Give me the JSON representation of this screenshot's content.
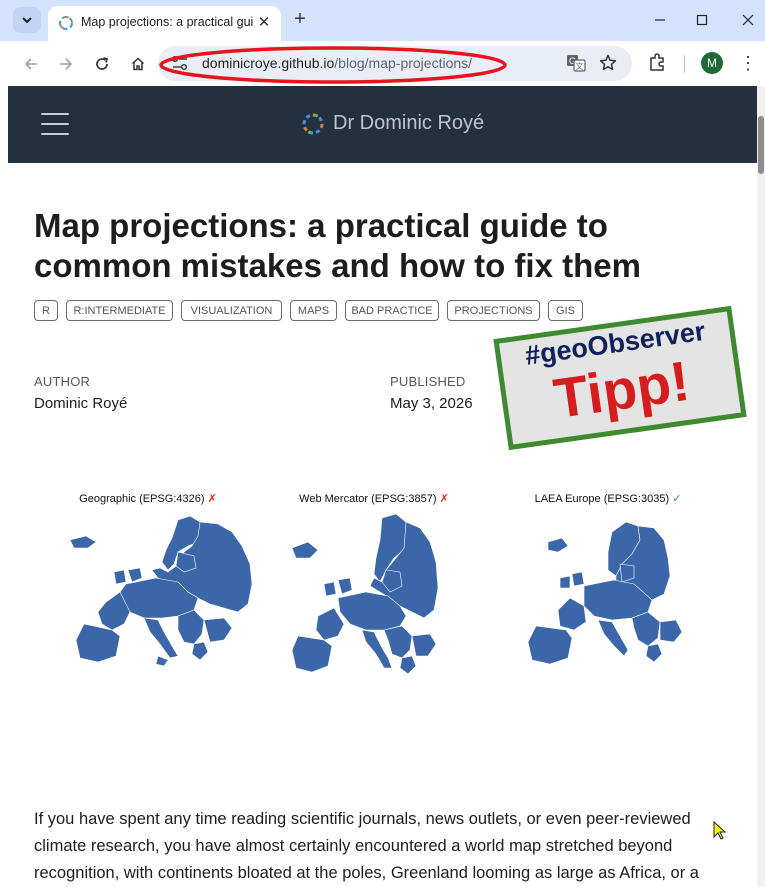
{
  "browser": {
    "tab": {
      "title": "Map projections: a practical guide to common mistakes and how to fix them"
    },
    "url": {
      "host": "dominicroye.github.io",
      "path": "/blog/map-projections/"
    },
    "profile_initial": "M",
    "icons": [
      "tab-search-icon",
      "favicon-icon",
      "close-icon",
      "new-tab-icon",
      "minimize-icon",
      "maximize-icon",
      "window-close-icon",
      "back-icon",
      "forward-icon",
      "reload-icon",
      "home-icon",
      "site-info-icon",
      "translate-icon",
      "star-icon",
      "extensions-icon",
      "more-icon"
    ],
    "annotation_color": "#e8141c"
  },
  "site": {
    "name": "Dr Dominic Royé",
    "header_color": "#24303e"
  },
  "post": {
    "title": "Map projections: a practical guide to common mistakes and how to fix them",
    "tags": [
      "R",
      "R:INTERMEDIATE",
      "VISUALIZATION",
      "MAPS",
      "BAD PRACTICE",
      "PROJECTIONS",
      "GIS"
    ],
    "author_label": "AUTHOR",
    "author": "Dominic Royé",
    "published_label": "PUBLISHED",
    "published": "May 3, 2026",
    "figure": {
      "panels": [
        {
          "title": "Geographic (EPSG:4326)",
          "mark": "✗"
        },
        {
          "title": "Web Mercator (EPSG:3857)",
          "mark": "✗"
        },
        {
          "title": "LAEA Europe (EPSG:3035)",
          "mark": "✓"
        }
      ],
      "fill_color": "#3b66a8"
    },
    "intro": "If you have spent any time reading scientific journals, news outlets, or even peer-reviewed climate research, you have almost certainly encountered a world map stretched beyond recognition, with continents bloated at the poles, Greenland looming as large as Africa, or a"
  },
  "overlay_stamp": {
    "line1": "#geoObserver",
    "line2": "Tipp!",
    "border_color": "#3d8a2f",
    "line1_color": "#10215c",
    "line2_color": "#d51d1d"
  }
}
